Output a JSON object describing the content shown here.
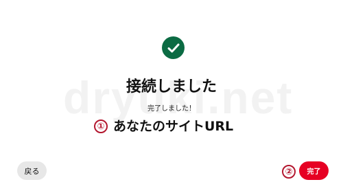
{
  "watermark": "dryuki.net",
  "status": {
    "icon": "checkmark-icon",
    "icon_color": "#0b6b43",
    "title": "接続しました",
    "subtitle": "完了しました！"
  },
  "annotations": {
    "marker_1": "①",
    "marker_2": "②",
    "marker_color": "#b3162e"
  },
  "site_url_label": "あなたのサイトURL",
  "buttons": {
    "back_label": "戻る",
    "done_label": "完了",
    "done_color": "#e60023"
  }
}
